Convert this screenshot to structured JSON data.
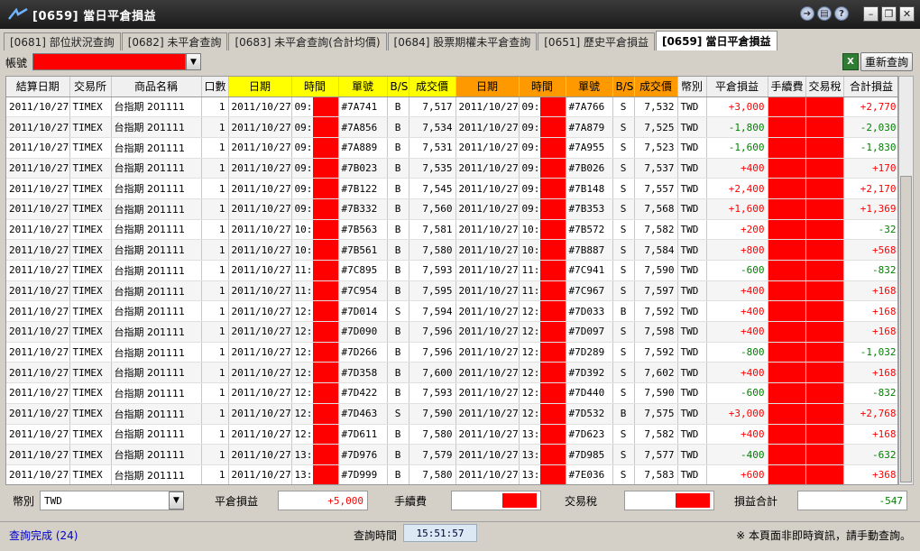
{
  "window": {
    "title": "[0659] 當日平倉損益"
  },
  "tabs": [
    "[0681] 部位狀況查詢",
    "[0682] 未平倉查詢",
    "[0683] 未平倉查詢(合計均價)",
    "[0684] 股票期權未平倉查詢",
    "[0651] 歷史平倉損益",
    "[0659] 當日平倉損益"
  ],
  "account": {
    "label": "帳號",
    "refresh_label": "重新查詢",
    "excel_icon": "X"
  },
  "columns": [
    "結算日期",
    "交易所",
    "商品名稱",
    "口數",
    "日期",
    "時間",
    "單號",
    "B/S",
    "成交價",
    "日期",
    "時間",
    "單號",
    "B/S",
    "成交價",
    "幣別",
    "平倉損益",
    "手續費",
    "交易稅",
    "合計損益"
  ],
  "rows": [
    [
      "2011/10/27",
      "TIMEX",
      "台指期 201111",
      "1",
      "2011/10/27",
      "09:",
      "#7A741",
      "B",
      "7,517",
      "2011/10/27",
      "09:",
      "#7A766",
      "S",
      "7,532",
      "TWD",
      "+3,000",
      "",
      "",
      "+2,770"
    ],
    [
      "2011/10/27",
      "TIMEX",
      "台指期 201111",
      "1",
      "2011/10/27",
      "09:",
      "#7A856",
      "B",
      "7,534",
      "2011/10/27",
      "09:",
      "#7A879",
      "S",
      "7,525",
      "TWD",
      "-1,800",
      "",
      "",
      "-2,030"
    ],
    [
      "2011/10/27",
      "TIMEX",
      "台指期 201111",
      "1",
      "2011/10/27",
      "09:",
      "#7A889",
      "B",
      "7,531",
      "2011/10/27",
      "09:",
      "#7A955",
      "S",
      "7,523",
      "TWD",
      "-1,600",
      "",
      "",
      "-1,830"
    ],
    [
      "2011/10/27",
      "TIMEX",
      "台指期 201111",
      "1",
      "2011/10/27",
      "09:",
      "#7B023",
      "B",
      "7,535",
      "2011/10/27",
      "09:",
      "#7B026",
      "S",
      "7,537",
      "TWD",
      "+400",
      "",
      "",
      "+170"
    ],
    [
      "2011/10/27",
      "TIMEX",
      "台指期 201111",
      "1",
      "2011/10/27",
      "09:",
      "#7B122",
      "B",
      "7,545",
      "2011/10/27",
      "09:",
      "#7B148",
      "S",
      "7,557",
      "TWD",
      "+2,400",
      "",
      "",
      "+2,170"
    ],
    [
      "2011/10/27",
      "TIMEX",
      "台指期 201111",
      "1",
      "2011/10/27",
      "09:",
      "#7B332",
      "B",
      "7,560",
      "2011/10/27",
      "09:",
      "#7B353",
      "S",
      "7,568",
      "TWD",
      "+1,600",
      "",
      "",
      "+1,369"
    ],
    [
      "2011/10/27",
      "TIMEX",
      "台指期 201111",
      "1",
      "2011/10/27",
      "10:",
      "#7B563",
      "B",
      "7,581",
      "2011/10/27",
      "10:",
      "#7B572",
      "S",
      "7,582",
      "TWD",
      "+200",
      "",
      "",
      "-32"
    ],
    [
      "2011/10/27",
      "TIMEX",
      "台指期 201111",
      "1",
      "2011/10/27",
      "10:",
      "#7B561",
      "B",
      "7,580",
      "2011/10/27",
      "10:",
      "#7B887",
      "S",
      "7,584",
      "TWD",
      "+800",
      "",
      "",
      "+568"
    ],
    [
      "2011/10/27",
      "TIMEX",
      "台指期 201111",
      "1",
      "2011/10/27",
      "11:",
      "#7C895",
      "B",
      "7,593",
      "2011/10/27",
      "11:",
      "#7C941",
      "S",
      "7,590",
      "TWD",
      "-600",
      "",
      "",
      "-832"
    ],
    [
      "2011/10/27",
      "TIMEX",
      "台指期 201111",
      "1",
      "2011/10/27",
      "11:",
      "#7C954",
      "B",
      "7,595",
      "2011/10/27",
      "11:",
      "#7C967",
      "S",
      "7,597",
      "TWD",
      "+400",
      "",
      "",
      "+168"
    ],
    [
      "2011/10/27",
      "TIMEX",
      "台指期 201111",
      "1",
      "2011/10/27",
      "12:",
      "#7D014",
      "S",
      "7,594",
      "2011/10/27",
      "12:",
      "#7D033",
      "B",
      "7,592",
      "TWD",
      "+400",
      "",
      "",
      "+168"
    ],
    [
      "2011/10/27",
      "TIMEX",
      "台指期 201111",
      "1",
      "2011/10/27",
      "12:",
      "#7D090",
      "B",
      "7,596",
      "2011/10/27",
      "12:",
      "#7D097",
      "S",
      "7,598",
      "TWD",
      "+400",
      "",
      "",
      "+168"
    ],
    [
      "2011/10/27",
      "TIMEX",
      "台指期 201111",
      "1",
      "2011/10/27",
      "12:",
      "#7D266",
      "B",
      "7,596",
      "2011/10/27",
      "12:",
      "#7D289",
      "S",
      "7,592",
      "TWD",
      "-800",
      "",
      "",
      "-1,032"
    ],
    [
      "2011/10/27",
      "TIMEX",
      "台指期 201111",
      "1",
      "2011/10/27",
      "12:",
      "#7D358",
      "B",
      "7,600",
      "2011/10/27",
      "12:",
      "#7D392",
      "S",
      "7,602",
      "TWD",
      "+400",
      "",
      "",
      "+168"
    ],
    [
      "2011/10/27",
      "TIMEX",
      "台指期 201111",
      "1",
      "2011/10/27",
      "12:",
      "#7D422",
      "B",
      "7,593",
      "2011/10/27",
      "12:",
      "#7D440",
      "S",
      "7,590",
      "TWD",
      "-600",
      "",
      "",
      "-832"
    ],
    [
      "2011/10/27",
      "TIMEX",
      "台指期 201111",
      "1",
      "2011/10/27",
      "12:",
      "#7D463",
      "S",
      "7,590",
      "2011/10/27",
      "12:",
      "#7D532",
      "B",
      "7,575",
      "TWD",
      "+3,000",
      "",
      "",
      "+2,768"
    ],
    [
      "2011/10/27",
      "TIMEX",
      "台指期 201111",
      "1",
      "2011/10/27",
      "12:",
      "#7D611",
      "B",
      "7,580",
      "2011/10/27",
      "13:",
      "#7D623",
      "S",
      "7,582",
      "TWD",
      "+400",
      "",
      "",
      "+168"
    ],
    [
      "2011/10/27",
      "TIMEX",
      "台指期 201111",
      "1",
      "2011/10/27",
      "13:",
      "#7D976",
      "B",
      "7,579",
      "2011/10/27",
      "13:",
      "#7D985",
      "S",
      "7,577",
      "TWD",
      "-400",
      "",
      "",
      "-632"
    ],
    [
      "2011/10/27",
      "TIMEX",
      "台指期 201111",
      "1",
      "2011/10/27",
      "13:",
      "#7D999",
      "B",
      "7,580",
      "2011/10/27",
      "13:",
      "#7E036",
      "S",
      "7,583",
      "TWD",
      "+600",
      "",
      "",
      "+368"
    ]
  ],
  "totals": {
    "currency_label": "幣別",
    "currency_value": "TWD",
    "pnl_label": "平倉損益",
    "pnl_value": "+5,000",
    "fee_label": "手續費",
    "tax_label": "交易稅",
    "total_label": "損益合計",
    "total_value": "-547"
  },
  "status": {
    "left": "查詢完成 (24)",
    "query_time_label": "查詢時間",
    "query_time": "15:51:57",
    "note": "※ 本頁面非即時資訊，請手動查詢。"
  },
  "colors": {
    "buy_header": "#ffff00",
    "sell_header": "#ff9900",
    "positive": "#ff0000",
    "negative": "#008000",
    "mask": "#ff0000"
  }
}
